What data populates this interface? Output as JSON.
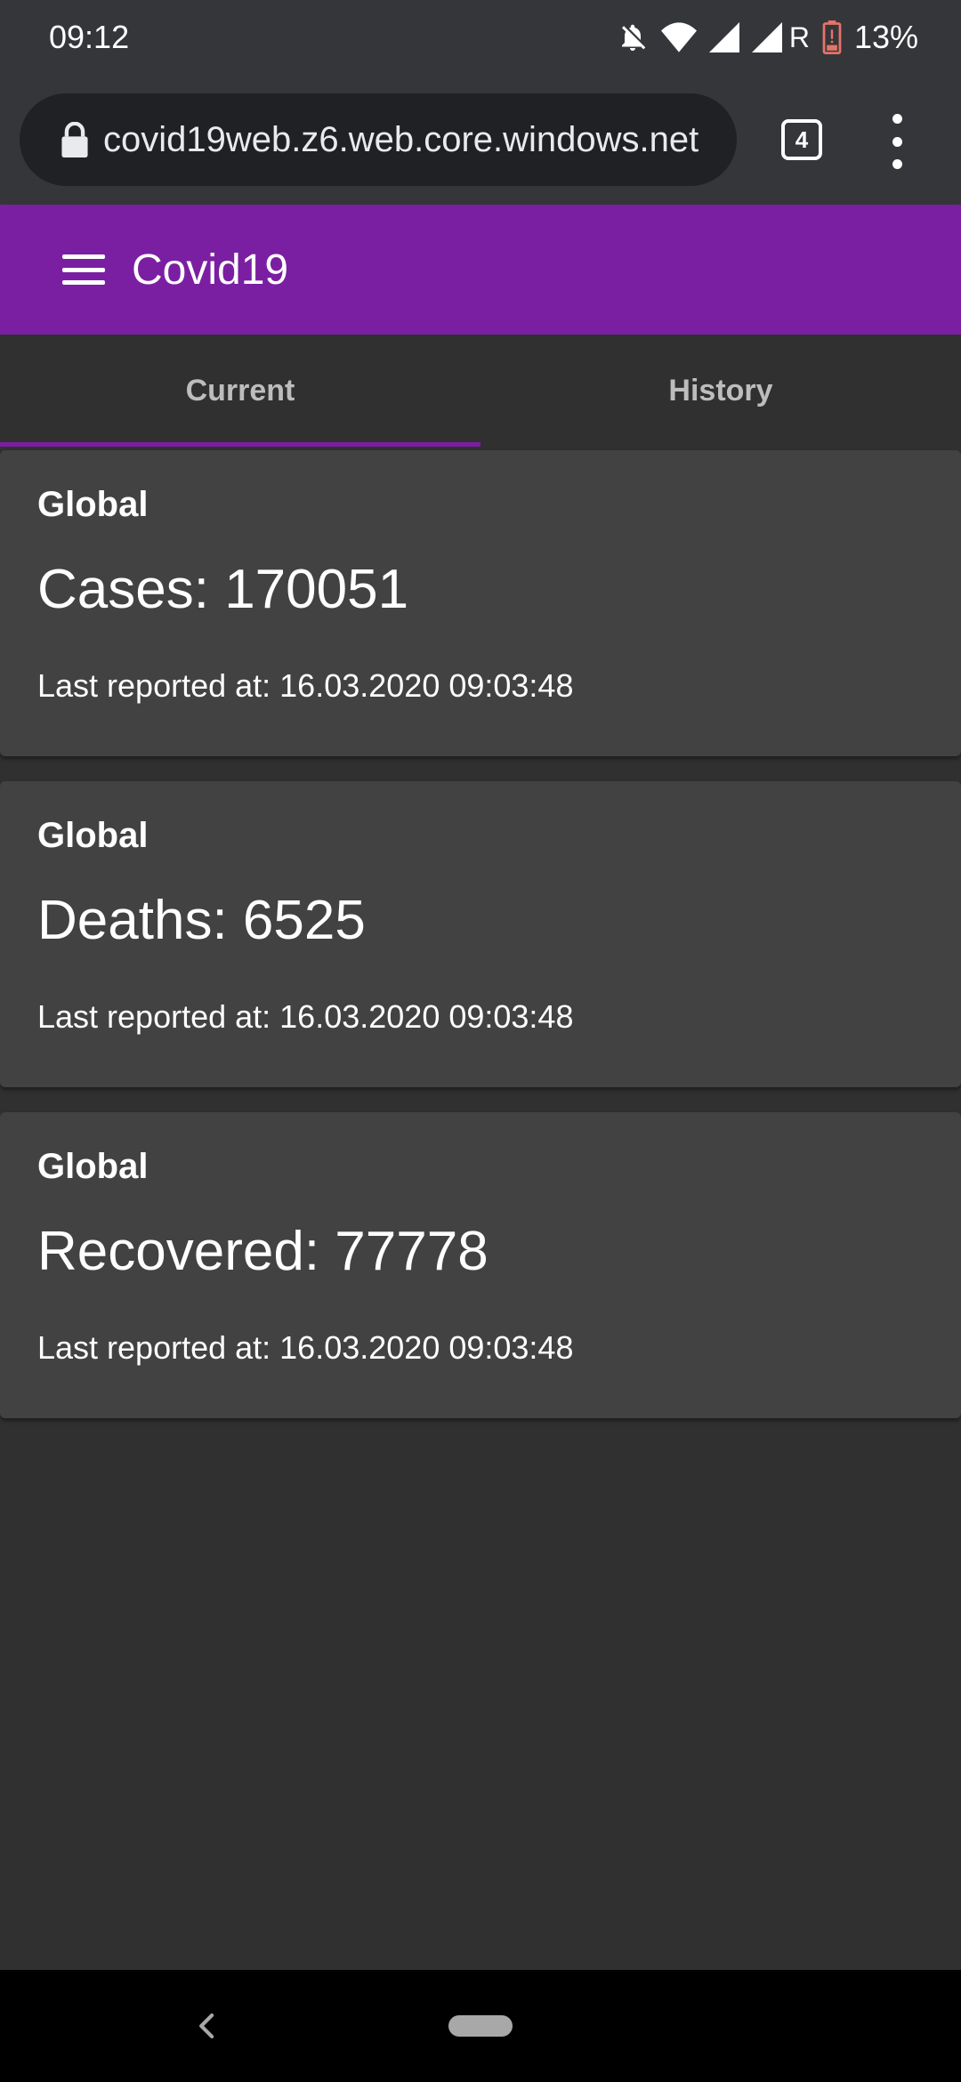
{
  "status_bar": {
    "time": "09:12",
    "roaming_indicator": "R",
    "battery_percent": "13%",
    "icons": [
      "notifications-off-icon",
      "wifi-icon",
      "signal-icon",
      "signal-icon",
      "battery-low-icon"
    ]
  },
  "browser": {
    "url": "covid19web.z6.web.core.windows.net",
    "tab_count": "4",
    "icons": [
      "lock-icon",
      "tabs-icon",
      "more-vert-icon"
    ]
  },
  "app_bar": {
    "title": "Covid19",
    "color": "#7b1fa2",
    "icons": [
      "menu-icon"
    ]
  },
  "tabs": [
    {
      "label": "Current",
      "active": true
    },
    {
      "label": "History",
      "active": false
    }
  ],
  "cards": [
    {
      "label": "Global",
      "value": "Cases: 170051",
      "reported": "Last reported at: 16.03.2020 09:03:48"
    },
    {
      "label": "Global",
      "value": "Deaths: 6525",
      "reported": "Last reported at: 16.03.2020 09:03:48"
    },
    {
      "label": "Global",
      "value": "Recovered: 77778",
      "reported": "Last reported at: 16.03.2020 09:03:48"
    }
  ],
  "nav_bar": {
    "icons": [
      "back-icon",
      "home-icon"
    ]
  }
}
